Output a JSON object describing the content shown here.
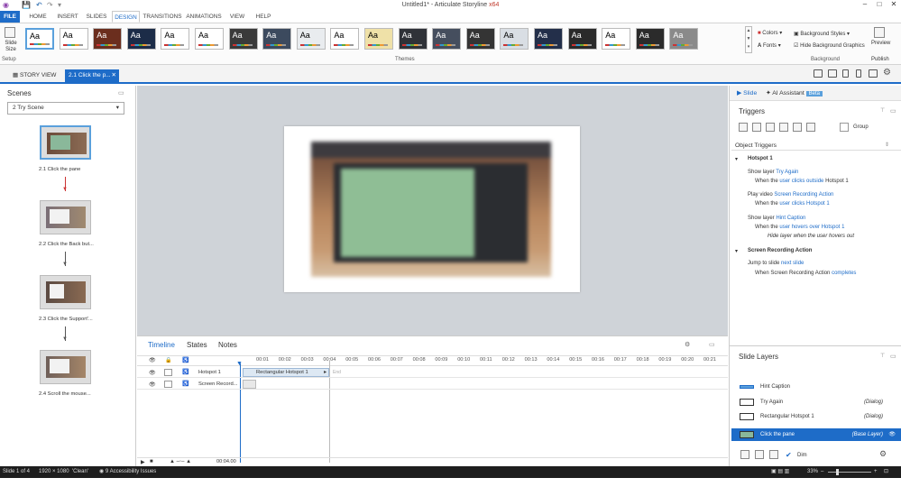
{
  "titlebar": {
    "title": "Untitled1* - Articulate Storyline",
    "arch": "x64"
  },
  "menu": {
    "file": "FILE",
    "items": [
      "HOME",
      "INSERT",
      "SLIDES",
      "DESIGN",
      "TRANSITIONS",
      "ANIMATIONS",
      "VIEW",
      "HELP"
    ],
    "active": "DESIGN"
  },
  "ribbon": {
    "slide_size": "Slide Size",
    "setup": "Setup",
    "theme_label": "Aa",
    "themes_group": "Themes",
    "colors": "Colors",
    "fonts": "Fonts",
    "background_styles": "Background Styles",
    "hide_background": "Hide Background Graphics",
    "background_group": "Background",
    "preview": "Preview",
    "publish": "Publish",
    "theme_count": 20
  },
  "tabs": {
    "story_view": "STORY VIEW",
    "current": "2.1 Click the p..."
  },
  "scenes": {
    "title": "Scenes",
    "selected": "2 Try Scene",
    "slides": [
      "2.1 Click the pane",
      "2.2 Click the Back but...",
      "2.3 Click the Support'...",
      "2.4 Scroll the mouse..."
    ]
  },
  "timeline": {
    "tabs": [
      "Timeline",
      "States",
      "Notes"
    ],
    "ticks": [
      "00:01",
      "00:02",
      "00:03",
      "00:04",
      "00:05",
      "00:06",
      "00:07",
      "00:08",
      "00:09",
      "00:10",
      "00:11",
      "00:12",
      "00:13",
      "00:14",
      "00:15",
      "00:16",
      "00:17",
      "00:18",
      "00:19",
      "00:20",
      "00:21"
    ],
    "rows": [
      {
        "name": "Hotspot 1",
        "bar": "Rectangular Hotspot 1",
        "end": "End"
      },
      {
        "name": "Screen Record..."
      }
    ],
    "duration": "00:04.00"
  },
  "right": {
    "tab_slide": "Slide",
    "tab_ai": "AI Assistant",
    "beta": "Beta",
    "triggers": "Triggers",
    "group": "Group",
    "object_triggers": "Object Triggers",
    "hotspot": "Hotspot 1",
    "t1a": "Show layer",
    "t1b": "Try Again",
    "t1c": "When the",
    "t1d": "user clicks outside",
    "t1e": "Hotspot 1",
    "t2a": "Play video",
    "t2b": "Screen Recording Action",
    "t2c": "When the",
    "t2d": "user clicks",
    "t2e": "Hotspot 1",
    "t3a": "Show layer",
    "t3b": "Hint Caption",
    "t3c": "When the",
    "t3d": "user hovers over",
    "t3e": "Hotspot 1",
    "t3f": "Hide layer when the user hovers out",
    "recording": "Screen Recording Action",
    "t4a": "Jump to slide",
    "t4b": "next slide",
    "t4c": "When Screen Recording Action",
    "t4d": "completes",
    "slide_layers": "Slide Layers",
    "layers": [
      {
        "name": "Hint Caption",
        "type": ""
      },
      {
        "name": "Try Again",
        "type": "(Dialog)"
      },
      {
        "name": "Rectangular Hotspot 1",
        "type": "(Dialog)"
      },
      {
        "name": "Click the pane",
        "type": "(Base Layer)"
      }
    ],
    "dim": "Dim"
  },
  "status": {
    "slide": "Slide 1 of 4",
    "res": "1920 × 1080",
    "theme": "'Clean'",
    "issues": "9 Accessibility Issues",
    "zoom": "33%"
  }
}
